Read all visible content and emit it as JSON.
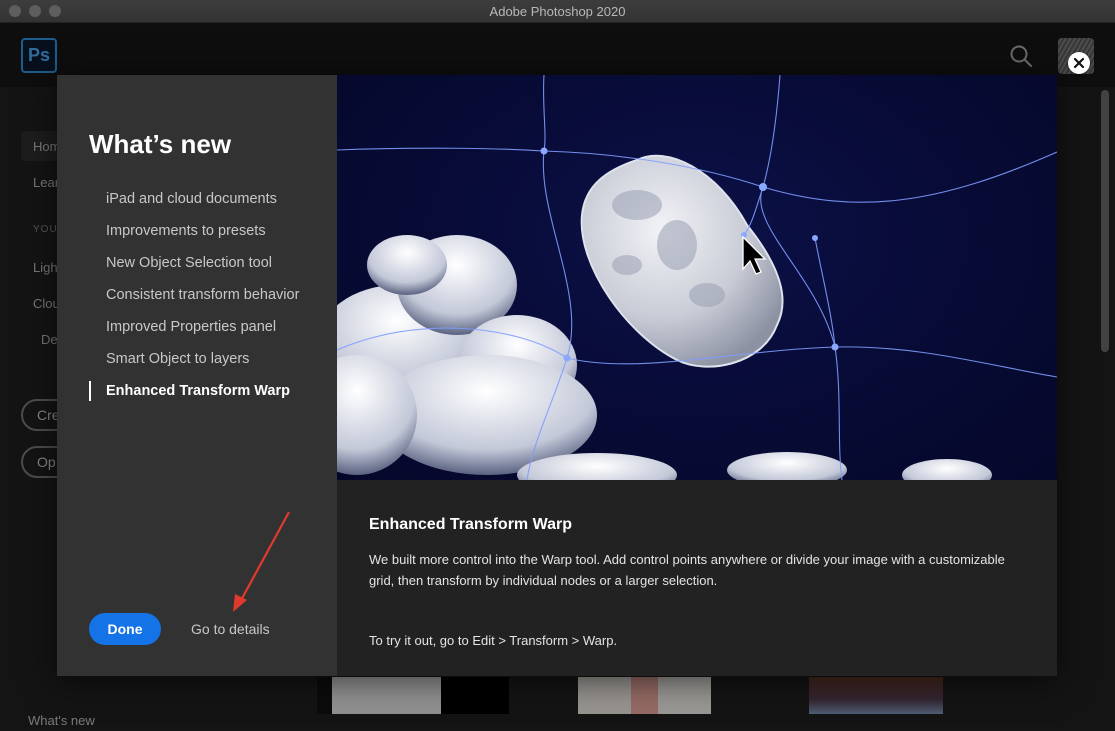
{
  "window": {
    "title": "Adobe Photoshop 2020"
  },
  "appbar": {
    "logo": "Ps",
    "search_icon": "search-icon",
    "avatar_icon": "avatar"
  },
  "sidebar": {
    "items": [
      {
        "label": "Hom"
      },
      {
        "label": "Lear"
      },
      {
        "label": "YOU"
      },
      {
        "label": "Ligh"
      },
      {
        "label": "Clou"
      },
      {
        "label": "De"
      }
    ],
    "create_label": "Cre",
    "open_label": "Op",
    "footer_label": "What's new"
  },
  "modal": {
    "heading": "What’s new",
    "nav": [
      {
        "label": "iPad and cloud documents"
      },
      {
        "label": "Improvements to presets"
      },
      {
        "label": "New Object Selection tool"
      },
      {
        "label": "Consistent transform behavior"
      },
      {
        "label": "Improved Properties panel"
      },
      {
        "label": "Smart Object to layers"
      },
      {
        "label": "Enhanced Transform Warp",
        "active": true
      }
    ],
    "done_label": "Done",
    "details_label": "Go to details",
    "feature": {
      "title": "Enhanced Transform Warp",
      "body": "We built more control into the Warp tool. Add control points anywhere or divide your image with a customizable grid, then transform by individual nodes or a larger selection.",
      "try_text": "To try it out, go to Edit > Transform > Warp."
    }
  },
  "colors": {
    "accent": "#1473e6",
    "annotation_arrow": "#e03a2e",
    "warp_grid": "#7f9cff"
  }
}
